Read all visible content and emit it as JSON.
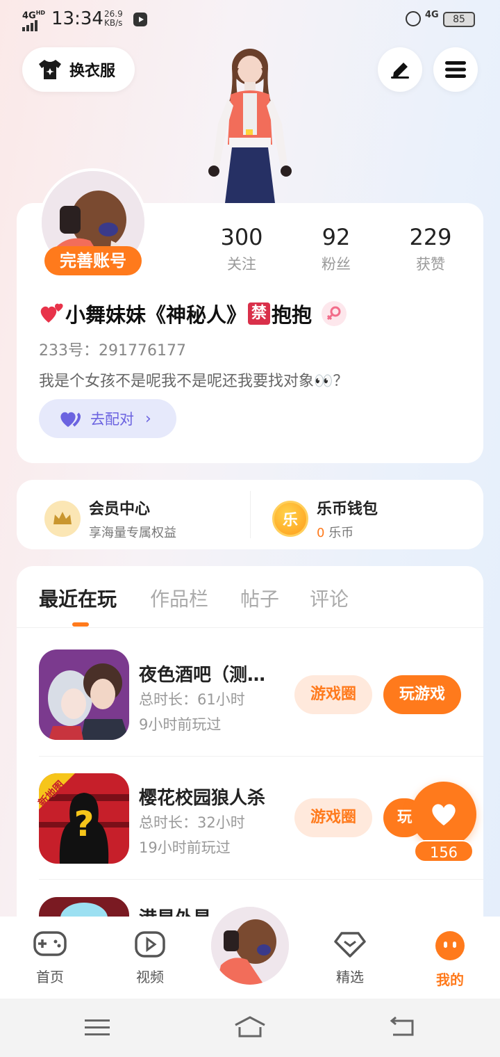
{
  "status_bar": {
    "network": "4G",
    "hd": "HD",
    "time": "13:34",
    "speed_value": "26.9",
    "speed_unit": "KB/s",
    "net_type": "4G",
    "battery": "85"
  },
  "header": {
    "dress_label": "换衣服"
  },
  "profile": {
    "complete_label": "完善账号",
    "stats": [
      {
        "value": "300",
        "label": "关注"
      },
      {
        "value": "92",
        "label": "粉丝"
      },
      {
        "value": "229",
        "label": "获赞"
      }
    ],
    "name": "小舞妹妹《神秘人》",
    "ban_badge": "禁",
    "name_suffix": "抱抱",
    "uid": "233号：291776177",
    "bio": "我是个女孩不是呢我不是呢还我要找对象👀？",
    "match_label": "去配对"
  },
  "member": {
    "vip_title": "会员中心",
    "vip_sub": "享海量专属权益",
    "wallet_title": "乐币钱包",
    "wallet_amount": "0",
    "wallet_unit": "乐币",
    "coin_char": "乐"
  },
  "tabs": [
    {
      "label": "最近在玩"
    },
    {
      "label": "作品栏"
    },
    {
      "label": "帖子"
    },
    {
      "label": "评论"
    }
  ],
  "games": [
    {
      "name": "夜色酒吧（测…",
      "duration": "总时长：61小时",
      "last": "9小时前玩过",
      "circle": "游戏圈",
      "play": "玩游戏"
    },
    {
      "name": "樱花校园狼人杀",
      "duration": "总时长：32小时",
      "last": "19小时前玩过",
      "circle": "游戏圈",
      "play": "玩",
      "badge": "新地图"
    },
    {
      "name": "港星外星"
    }
  ],
  "float_like": {
    "count": "156"
  },
  "nav": [
    {
      "label": "首页"
    },
    {
      "label": "视频"
    },
    {
      "label": "精选"
    },
    {
      "label": "我的"
    }
  ],
  "colors": {
    "accent": "#ff7a1c",
    "match": "#6b63e0"
  }
}
